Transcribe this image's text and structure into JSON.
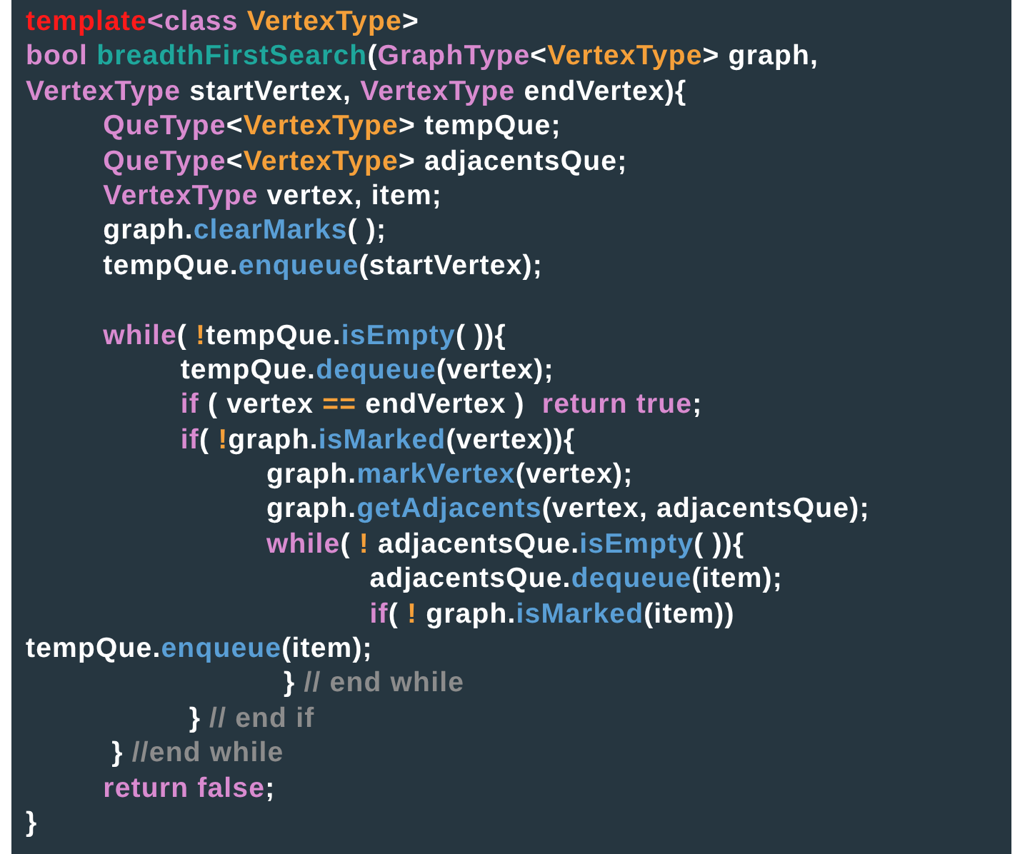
{
  "code_lines": [
    {
      "kind": "code",
      "tokens": [
        {
          "text": "template",
          "kind": "template"
        },
        {
          "text": "<class ",
          "kind": "keyword"
        },
        {
          "text": "VertexType",
          "kind": "type"
        },
        {
          "text": ">",
          "kind": "plain"
        }
      ]
    },
    {
      "kind": "code",
      "tokens": [
        {
          "text": "bool ",
          "kind": "keyword"
        },
        {
          "text": "breadthFirstSearch",
          "kind": "function"
        },
        {
          "text": "(",
          "kind": "plain"
        },
        {
          "text": "GraphType",
          "kind": "keyword"
        },
        {
          "text": "<",
          "kind": "plain"
        },
        {
          "text": "VertexType",
          "kind": "type"
        },
        {
          "text": "> graph,",
          "kind": "plain"
        }
      ]
    },
    {
      "kind": "code",
      "tokens": [
        {
          "text": "VertexType",
          "kind": "keyword"
        },
        {
          "text": " startVertex, ",
          "kind": "plain"
        },
        {
          "text": "VertexType",
          "kind": "keyword"
        },
        {
          "text": " endVertex){",
          "kind": "plain"
        }
      ]
    },
    {
      "kind": "code",
      "tokens": [
        {
          "text": "         QueType",
          "kind": "keyword"
        },
        {
          "text": "<",
          "kind": "plain"
        },
        {
          "text": "VertexType",
          "kind": "type"
        },
        {
          "text": "> tempQue;",
          "kind": "plain"
        }
      ]
    },
    {
      "kind": "code",
      "tokens": [
        {
          "text": "         QueType",
          "kind": "keyword"
        },
        {
          "text": "<",
          "kind": "plain"
        },
        {
          "text": "VertexType",
          "kind": "type"
        },
        {
          "text": "> adjacentsQue;",
          "kind": "plain"
        }
      ]
    },
    {
      "kind": "code",
      "tokens": [
        {
          "text": "         VertexType",
          "kind": "keyword"
        },
        {
          "text": " vertex, item;",
          "kind": "plain"
        }
      ]
    },
    {
      "kind": "code",
      "tokens": [
        {
          "text": "         graph.",
          "kind": "plain"
        },
        {
          "text": "clearMarks",
          "kind": "method"
        },
        {
          "text": "( );",
          "kind": "plain"
        }
      ]
    },
    {
      "kind": "code",
      "tokens": [
        {
          "text": "         tempQue.",
          "kind": "plain"
        },
        {
          "text": "enqueue",
          "kind": "method"
        },
        {
          "text": "(startVertex);",
          "kind": "plain"
        }
      ]
    },
    {
      "kind": "blank"
    },
    {
      "kind": "code",
      "tokens": [
        {
          "text": "         while",
          "kind": "keyword"
        },
        {
          "text": "( ",
          "kind": "plain"
        },
        {
          "text": "!",
          "kind": "operator"
        },
        {
          "text": "tempQue.",
          "kind": "plain"
        },
        {
          "text": "isEmpty",
          "kind": "method"
        },
        {
          "text": "( )){",
          "kind": "plain"
        }
      ]
    },
    {
      "kind": "code",
      "tokens": [
        {
          "text": "                  tempQue.",
          "kind": "plain"
        },
        {
          "text": "dequeue",
          "kind": "method"
        },
        {
          "text": "(vertex);",
          "kind": "plain"
        }
      ]
    },
    {
      "kind": "code",
      "tokens": [
        {
          "text": "                  if",
          "kind": "keyword"
        },
        {
          "text": " ( vertex ",
          "kind": "plain"
        },
        {
          "text": "==",
          "kind": "operator"
        },
        {
          "text": " endVertex )  ",
          "kind": "plain"
        },
        {
          "text": "return true",
          "kind": "keyword"
        },
        {
          "text": ";",
          "kind": "plain"
        }
      ]
    },
    {
      "kind": "code",
      "tokens": [
        {
          "text": "                  if",
          "kind": "keyword"
        },
        {
          "text": "( ",
          "kind": "plain"
        },
        {
          "text": "!",
          "kind": "operator"
        },
        {
          "text": "graph.",
          "kind": "plain"
        },
        {
          "text": "isMarked",
          "kind": "method"
        },
        {
          "text": "(vertex)){",
          "kind": "plain"
        }
      ]
    },
    {
      "kind": "code",
      "tokens": [
        {
          "text": "                            graph.",
          "kind": "plain"
        },
        {
          "text": "markVertex",
          "kind": "method"
        },
        {
          "text": "(vertex);",
          "kind": "plain"
        }
      ]
    },
    {
      "kind": "code",
      "tokens": [
        {
          "text": "                            graph.",
          "kind": "plain"
        },
        {
          "text": "getAdjacents",
          "kind": "method"
        },
        {
          "text": "(vertex, adjacentsQue);",
          "kind": "plain"
        }
      ]
    },
    {
      "kind": "code",
      "tokens": [
        {
          "text": "                            while",
          "kind": "keyword"
        },
        {
          "text": "( ",
          "kind": "plain"
        },
        {
          "text": "!",
          "kind": "operator"
        },
        {
          "text": " adjacentsQue.",
          "kind": "plain"
        },
        {
          "text": "isEmpty",
          "kind": "method"
        },
        {
          "text": "( )){",
          "kind": "plain"
        }
      ]
    },
    {
      "kind": "code",
      "tokens": [
        {
          "text": "                                        adjacentsQue.",
          "kind": "plain"
        },
        {
          "text": "dequeue",
          "kind": "method"
        },
        {
          "text": "(item);",
          "kind": "plain"
        }
      ]
    },
    {
      "kind": "code",
      "tokens": [
        {
          "text": "                                        if",
          "kind": "keyword"
        },
        {
          "text": "( ",
          "kind": "plain"
        },
        {
          "text": "!",
          "kind": "operator"
        },
        {
          "text": " graph.",
          "kind": "plain"
        },
        {
          "text": "isMarked",
          "kind": "method"
        },
        {
          "text": "(item))",
          "kind": "plain"
        }
      ]
    },
    {
      "kind": "code",
      "tokens": [
        {
          "text": "tempQue.",
          "kind": "plain"
        },
        {
          "text": "enqueue",
          "kind": "method"
        },
        {
          "text": "(item);",
          "kind": "plain"
        }
      ]
    },
    {
      "kind": "code",
      "tokens": [
        {
          "text": "                              } ",
          "kind": "plain"
        },
        {
          "text": "// end while",
          "kind": "comment"
        }
      ]
    },
    {
      "kind": "code",
      "tokens": [
        {
          "text": "                   } ",
          "kind": "plain"
        },
        {
          "text": "// end if",
          "kind": "comment"
        }
      ]
    },
    {
      "kind": "code",
      "tokens": [
        {
          "text": "          } ",
          "kind": "plain"
        },
        {
          "text": "//end while",
          "kind": "comment"
        }
      ]
    },
    {
      "kind": "code",
      "tokens": [
        {
          "text": "         return false",
          "kind": "keyword"
        },
        {
          "text": ";",
          "kind": "plain"
        }
      ]
    },
    {
      "kind": "code",
      "tokens": [
        {
          "text": "}",
          "kind": "plain"
        }
      ]
    }
  ]
}
